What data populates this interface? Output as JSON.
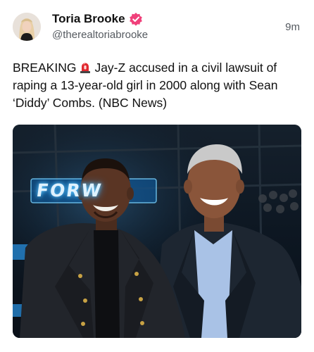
{
  "author": {
    "display_name": "Toria Brooke",
    "handle": "@therealtoriabrooke",
    "avatar_icon": "profile-photo",
    "verified_icon": "verified-badge-icon",
    "verified_color": "#f0407a"
  },
  "post": {
    "timestamp": "9m",
    "text_before_icon": "BREAKING",
    "icon": "siren-icon",
    "text_after_icon": "Jay-Z accused in a civil lawsuit of raping a 13-year-old girl in 2000 along with Sean ‘Diddy’ Combs. (NBC News)"
  },
  "media": {
    "sign_text": "FORW"
  }
}
